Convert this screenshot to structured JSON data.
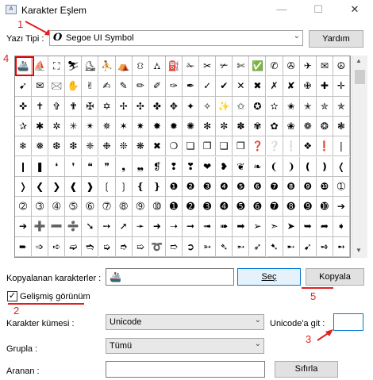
{
  "window": {
    "title": "Karakter Eşlem",
    "icon": "charmap-app-icon",
    "minimize_glyph": "—",
    "maximize_glyph": "☐",
    "close_glyph": "✕"
  },
  "font_row": {
    "label": "Yazı Tipi :",
    "font_glyph": "O",
    "font_value": "Segoe UI Symbol",
    "help_button": "Yardım"
  },
  "grid": {
    "selected_index": 0,
    "rows": [
      [
        "🚢",
        "⛵",
        "⛶",
        "⛷",
        "⛸",
        "⛹",
        "⛺",
        "⛻",
        "⛼",
        "⛽",
        "✁",
        "✂",
        "✃",
        "✄",
        "✅",
        "✆",
        "✇",
        "✈",
        "✉",
        "☮"
      ],
      [
        "➹",
        "✉",
        "🖂",
        "✋",
        "✌",
        "✍",
        "✎",
        "✏",
        "✐",
        "✑",
        "✒",
        "✓",
        "✔",
        "✕",
        "✖",
        "✗",
        "✘",
        "✙",
        "✚",
        "✛"
      ],
      [
        "✜",
        "✝",
        "✞",
        "✟",
        "✠",
        "✡",
        "✢",
        "✣",
        "✤",
        "✥",
        "✦",
        "✧",
        "✨",
        "✩",
        "✪",
        "✫",
        "✬",
        "✭",
        "✮",
        "✯"
      ],
      [
        "✰",
        "✱",
        "✲",
        "✳",
        "✴",
        "✵",
        "✶",
        "✷",
        "✸",
        "✹",
        "✺",
        "✻",
        "✼",
        "✽",
        "✾",
        "✿",
        "❀",
        "❁",
        "❂",
        "❃"
      ],
      [
        "❄",
        "❅",
        "❆",
        "❇",
        "❈",
        "❉",
        "❊",
        "❋",
        "✖",
        "❍",
        "❏",
        "❐",
        "❑",
        "❒",
        "❓",
        "❔",
        "❕",
        "❖",
        "❗",
        "❘"
      ],
      [
        "❙",
        "❚",
        "❛",
        "❜",
        "❝",
        "❞",
        "❟",
        "❠",
        "❡",
        "❢",
        "❣",
        "❤",
        "❥",
        "❦",
        "❧",
        "❨",
        "❩",
        "❪",
        "❫",
        "❬"
      ],
      [
        "❭",
        "❮",
        "❯",
        "❰",
        "❱",
        "❲",
        "❳",
        "❴",
        "❵",
        "❶",
        "❷",
        "❸",
        "❹",
        "❺",
        "❻",
        "❼",
        "❽",
        "❾",
        "❿",
        "➀"
      ],
      [
        "➁",
        "➂",
        "➃",
        "➄",
        "➅",
        "➆",
        "➇",
        "➈",
        "➉",
        "➊",
        "➋",
        "➌",
        "➍",
        "➎",
        "➏",
        "➐",
        "➑",
        "➒",
        "➓",
        "➔"
      ],
      [
        "➔",
        "➕",
        "➖",
        "➗",
        "➘",
        "➙",
        "➚",
        "➛",
        "➜",
        "➝",
        "➞",
        "➟",
        "➠",
        "➡",
        "➢",
        "➣",
        "➤",
        "➥",
        "➦",
        "➧"
      ],
      [
        "➨",
        "➩",
        "➪",
        "➫",
        "➬",
        "➭",
        "➮",
        "➯",
        "➰",
        "➱",
        "➲",
        "➳",
        "➴",
        "➵",
        "➶",
        "➷",
        "➸",
        "➹",
        "➺",
        "➻"
      ]
    ]
  },
  "copy_row": {
    "label": "Kopyalanan karakterler :",
    "value": "🚢",
    "select_button": "Seç",
    "copy_button": "Kopyala"
  },
  "advanced": {
    "checked": true,
    "check_glyph": "✓",
    "label": "Gelişmiş görünüm"
  },
  "charset": {
    "label": "Karakter kümesi :",
    "value": "Unicode",
    "goto_label": "Unicode'a git :",
    "goto_value": ""
  },
  "group": {
    "label": "Grupla :",
    "value": "Tümü"
  },
  "search": {
    "label": "Aranan :",
    "value": "",
    "button": "Sıfırla"
  },
  "annotations": {
    "n1": "1",
    "n2": "2",
    "n3": "3",
    "n4": "4",
    "n5": "5",
    "color": "#e02020"
  },
  "scrollbar": {
    "up_glyph": "▲",
    "down_glyph": "▼"
  }
}
